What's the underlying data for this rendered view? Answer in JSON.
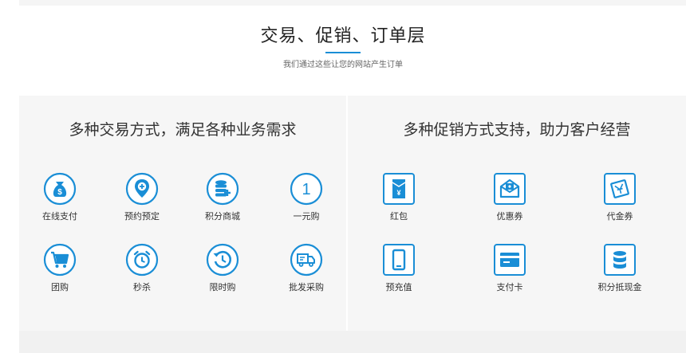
{
  "header": {
    "title": "交易、促销、订单层",
    "subtitle": "我们通过这些让您的网站产生订单"
  },
  "colors": {
    "accent": "#1a8ed6",
    "panel_bg": "#f6f6f6"
  },
  "left_panel": {
    "title": "多种交易方式，满足各种业务需求",
    "items": [
      {
        "label": "在线支付",
        "icon": "money-bag-icon"
      },
      {
        "label": "预约预定",
        "icon": "location-pin-icon"
      },
      {
        "label": "积分商城",
        "icon": "coin-stack-icon"
      },
      {
        "label": "一元购",
        "icon": "number-one-icon",
        "glyph": "1"
      },
      {
        "label": "团购",
        "icon": "shopping-cart-icon"
      },
      {
        "label": "秒杀",
        "icon": "alarm-clock-icon"
      },
      {
        "label": "限时购",
        "icon": "history-clock-icon"
      },
      {
        "label": "批发采购",
        "icon": "delivery-truck-icon"
      }
    ]
  },
  "right_panel": {
    "title": "多种促销方式支持，助力客户经营",
    "items": [
      {
        "label": "红包",
        "icon": "red-envelope-icon",
        "glyph": "¥"
      },
      {
        "label": "优惠券",
        "icon": "coupon-envelope-icon"
      },
      {
        "label": "代金券",
        "icon": "voucher-icon"
      },
      {
        "label": "预充值",
        "icon": "phone-recharge-icon"
      },
      {
        "label": "支付卡",
        "icon": "payment-card-icon"
      },
      {
        "label": "积分抵现金",
        "icon": "database-points-icon"
      }
    ]
  }
}
